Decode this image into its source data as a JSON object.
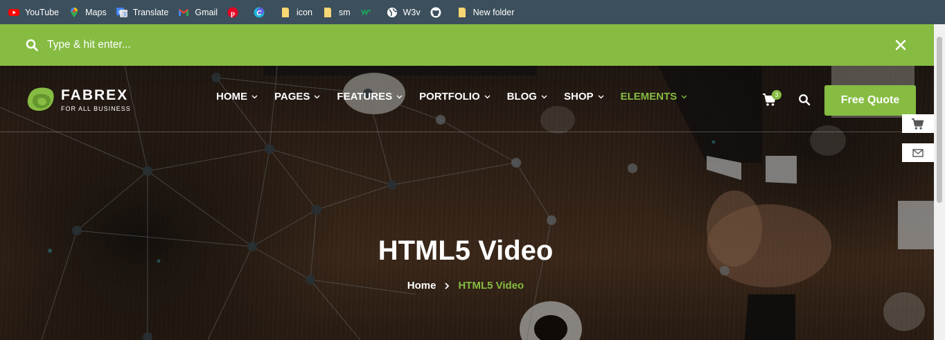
{
  "bookmarks": [
    {
      "label": "YouTube",
      "icon": "youtube-icon"
    },
    {
      "label": "Maps",
      "icon": "maps-icon"
    },
    {
      "label": "Translate",
      "icon": "translate-icon"
    },
    {
      "label": "Gmail",
      "icon": "gmail-icon"
    },
    {
      "label": "",
      "icon": "pinterest-icon"
    },
    {
      "label": "",
      "icon": "canva-icon"
    },
    {
      "label": "icon",
      "icon": "folder-icon"
    },
    {
      "label": "sm",
      "icon": "folder-icon"
    },
    {
      "label": "",
      "icon": "w-logo-icon"
    },
    {
      "label": "W3v",
      "icon": "globe-icon"
    },
    {
      "label": "",
      "icon": "github-icon"
    },
    {
      "label": "New folder",
      "icon": "folder-icon"
    }
  ],
  "search": {
    "placeholder": "Type & hit enter..."
  },
  "brand": {
    "name": "FABREX",
    "tagline": "FOR ALL BUSINESS"
  },
  "nav": {
    "items": [
      {
        "label": "HOME",
        "active": false
      },
      {
        "label": "PAGES",
        "active": false
      },
      {
        "label": "FEATURES",
        "active": false
      },
      {
        "label": "PORTFOLIO",
        "active": false
      },
      {
        "label": "BLOG",
        "active": false
      },
      {
        "label": "SHOP",
        "active": false
      },
      {
        "label": "ELEMENTS",
        "active": true
      }
    ]
  },
  "cart": {
    "count": "3"
  },
  "cta": {
    "label": "Free Quote"
  },
  "hero": {
    "title": "HTML5 Video"
  },
  "breadcrumb": {
    "home": "Home",
    "current": "HTML5 Video"
  },
  "colors": {
    "accent": "#86bc42",
    "bookmarks_bg": "#3c4f5c",
    "white": "#ffffff"
  }
}
